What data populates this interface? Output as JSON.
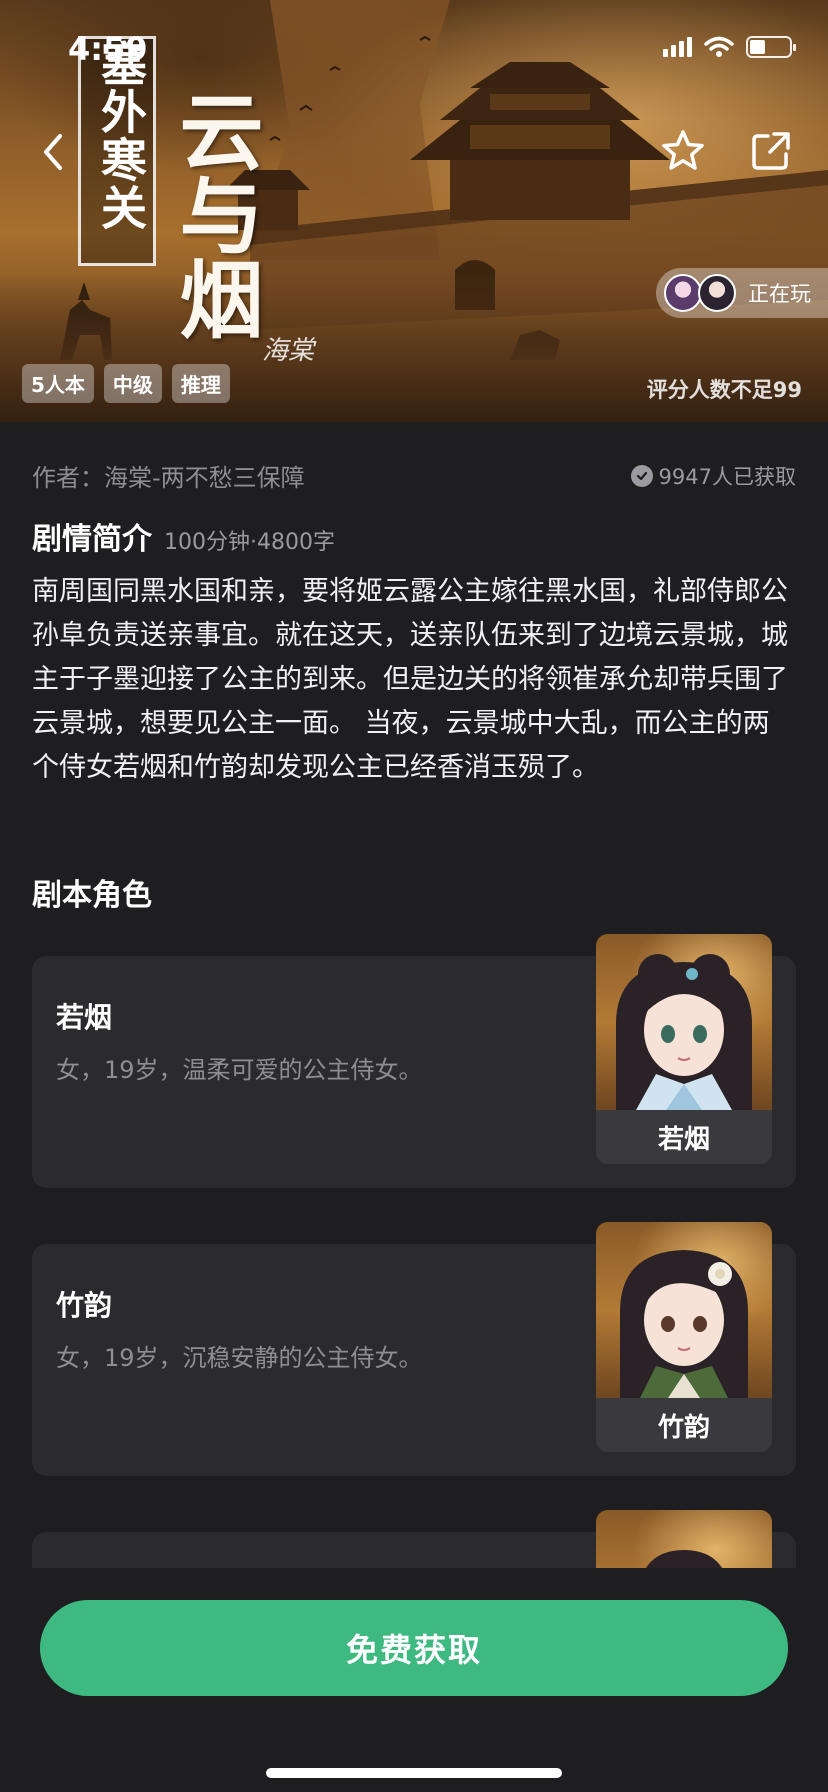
{
  "status_bar": {
    "time": "4:59"
  },
  "hero": {
    "title_vertical": "塞外寒关",
    "title_big": "云与烟",
    "signature": "海棠",
    "playing_label": "正在玩",
    "tags": [
      "5人本",
      "中级",
      "推理"
    ],
    "rating_note": "评分人数不足99"
  },
  "info": {
    "author": "作者：海棠-两不愁三保障",
    "obtained": "9947人已获取"
  },
  "synopsis": {
    "title": "剧情简介",
    "meta": "100分钟·4800字",
    "text": "南周国同黑水国和亲，要将姬云露公主嫁往黑水国，礼部侍郎公孙阜负责送亲事宜。就在这天，送亲队伍来到了边境云景城，城主于子墨迎接了公主的到来。但是边关的将领崔承允却带兵围了云景城，想要见公主一面。 当夜，云景城中大乱，而公主的两个侍女若烟和竹韵却发现公主已经香消玉殒了。"
  },
  "roles": {
    "title": "剧本角色",
    "items": [
      {
        "name": "若烟",
        "desc": "女，19岁，温柔可爱的公主侍女。",
        "portrait_label": "若烟"
      },
      {
        "name": "竹韵",
        "desc": "女，19岁，沉稳安静的公主侍女。",
        "portrait_label": "竹韵"
      }
    ]
  },
  "cta": {
    "label": "免费获取"
  },
  "colors": {
    "accent": "#3fb982",
    "background": "#1e1e20",
    "card": "#2b2b2e"
  }
}
